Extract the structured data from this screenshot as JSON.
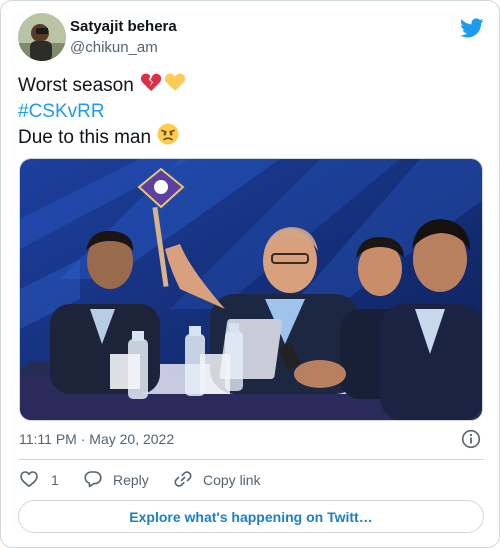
{
  "author": {
    "name": "Satyajit behera",
    "handle": "@chikun_am"
  },
  "tweet": {
    "line1": "Worst season",
    "line1_emojis": [
      "broken-heart",
      "yellow-heart"
    ],
    "hashtag": "#CSKvRR",
    "line3": "Due to this man",
    "line3_emoji": "angry-face"
  },
  "meta": {
    "timestamp": "11:11 PM · May 20, 2022"
  },
  "actions": {
    "like_count": "1",
    "reply_label": "Reply",
    "copy_label": "Copy link"
  },
  "explore_label": "Explore what's happening on Twitt…",
  "colors": {
    "twitter_blue": "#1d9bf0",
    "secondary_text": "#536471",
    "border": "#cfd9de"
  }
}
